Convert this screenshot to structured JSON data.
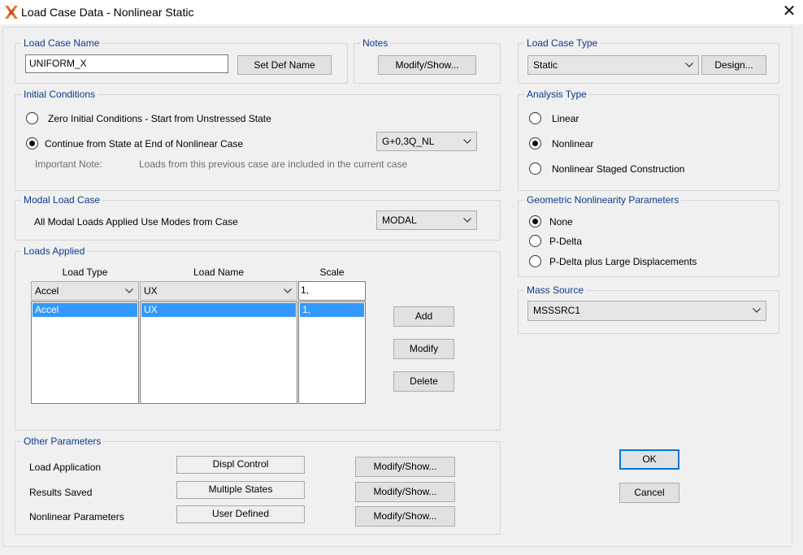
{
  "window": {
    "title": "Load Case Data - Nonlinear Static"
  },
  "load_case_name": {
    "legend": "Load Case Name",
    "value": "UNIFORM_X",
    "set_def_name_label": "Set Def Name"
  },
  "notes": {
    "legend": "Notes",
    "modify_show_label": "Modify/Show..."
  },
  "load_case_type": {
    "legend": "Load Case Type",
    "value": "Static",
    "design_label": "Design..."
  },
  "initial_conditions": {
    "legend": "Initial Conditions",
    "option_zero": "Zero Initial Conditions - Start from Unstressed State",
    "option_continue": "Continue from State at End of Nonlinear Case",
    "selected": "continue",
    "case_value": "G+0,3Q_NL",
    "note_label": "Important Note:",
    "note_text": "Loads from this previous case are included in the current case"
  },
  "analysis_type": {
    "legend": "Analysis Type",
    "options": [
      "Linear",
      "Nonlinear",
      "Nonlinear Staged Construction"
    ],
    "selected_index": 1
  },
  "modal_load_case": {
    "legend": "Modal Load Case",
    "label": "All Modal Loads Applied Use Modes from Case",
    "value": "MODAL"
  },
  "geometric_nonlinearity": {
    "legend": "Geometric Nonlinearity Parameters",
    "options": [
      "None",
      "P-Delta",
      "P-Delta plus Large Displacements"
    ],
    "selected_index": 0
  },
  "loads_applied": {
    "legend": "Loads Applied",
    "headers": {
      "load_type": "Load Type",
      "load_name": "Load Name",
      "scale": "Scale"
    },
    "edit_row": {
      "load_type": "Accel",
      "load_name": "UX",
      "scale": "1,"
    },
    "rows": [
      {
        "load_type": "Accel",
        "load_name": "UX",
        "scale": "1,"
      }
    ],
    "add_label": "Add",
    "modify_label": "Modify",
    "delete_label": "Delete"
  },
  "mass_source": {
    "legend": "Mass Source",
    "value": "MSSSRC1"
  },
  "other_parameters": {
    "legend": "Other Parameters",
    "rows": [
      {
        "label": "Load Application",
        "value": "Displ Control",
        "button": "Modify/Show..."
      },
      {
        "label": "Results Saved",
        "value": "Multiple States",
        "button": "Modify/Show..."
      },
      {
        "label": "Nonlinear Parameters",
        "value": "User Defined",
        "button": "Modify/Show..."
      }
    ]
  },
  "dialog_buttons": {
    "ok_label": "OK",
    "cancel_label": "Cancel"
  },
  "colors": {
    "legend_text": "#0b3a8c",
    "selection": "#3399ff",
    "default_button_border": "#0078d7"
  }
}
